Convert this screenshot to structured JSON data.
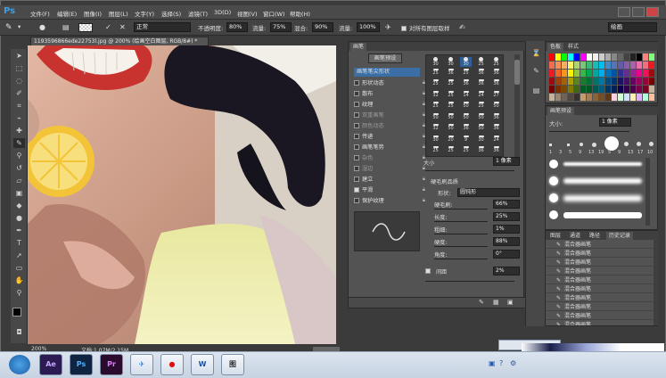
{
  "app": {
    "logo": "Ps"
  },
  "menu": [
    "文件(F)",
    "编辑(E)",
    "图像(I)",
    "图层(L)",
    "文字(Y)",
    "选择(S)",
    "滤镜(T)",
    "3D(D)",
    "视图(V)",
    "窗口(W)",
    "帮助(H)"
  ],
  "options": {
    "mode_value": "正常",
    "opacity_label": "不透明度:",
    "opacity_value": "80%",
    "flow_label": "流量:",
    "flow_value": "75%",
    "mix_label": "混合:",
    "mix_value": "90%",
    "flow2_label": "流量:",
    "flow2_value": "100%",
    "sample_all_label": "对所有图层取样",
    "workspace_value": "绘画"
  },
  "document": {
    "tab_title": "1193596866ede22753l.jpg @ 200% (绘画空白图层, RGB/8#) *",
    "zoom": "200%",
    "doc_info": "文档:1.07M/2.15M"
  },
  "brush_panel": {
    "tabs": [
      "画笔"
    ],
    "presets_button": "画笔预设",
    "tip_shape_label": "画笔笔尖形状",
    "options": [
      {
        "label": "形状动态",
        "checked": false
      },
      {
        "label": "散布",
        "checked": false
      },
      {
        "label": "纹理",
        "checked": false
      },
      {
        "label": "双重画笔",
        "checked": false
      },
      {
        "label": "颜色动态",
        "checked": false
      },
      {
        "label": "传递",
        "checked": false
      },
      {
        "label": "画笔笔势",
        "checked": false
      },
      {
        "label": "杂色",
        "checked": false
      },
      {
        "label": "湿边",
        "checked": false
      },
      {
        "label": "建立",
        "checked": false
      },
      {
        "label": "平滑",
        "checked": true
      },
      {
        "label": "保护纹理",
        "checked": false
      }
    ],
    "tip_sizes": [
      [
        "30",
        "30",
        "30",
        "25",
        "25"
      ],
      [
        "25",
        "36",
        "25",
        "36",
        "36"
      ],
      [
        "25",
        "25",
        "36",
        "36",
        "36"
      ],
      [
        "32",
        "25",
        "14",
        "24",
        "27"
      ],
      [
        "25",
        "25",
        "50",
        "25",
        "50"
      ],
      [
        "50",
        "50",
        "50",
        "50",
        "36"
      ],
      [
        "32",
        "50",
        "36",
        "50",
        "36"
      ],
      [
        "30",
        "20",
        "9",
        "30",
        "24"
      ],
      [
        "25",
        "25",
        "25",
        "36",
        "36"
      ]
    ],
    "size_label": "大小",
    "size_value": "1 像素",
    "bristle_title": "硬毛刷品质",
    "shape_label": "形状:",
    "shape_value": "圆钝形",
    "params": [
      {
        "label": "硬毛刷:",
        "value": "66%"
      },
      {
        "label": "长度:",
        "value": "25%"
      },
      {
        "label": "粗细:",
        "value": "1%"
      },
      {
        "label": "硬度:",
        "value": "88%"
      },
      {
        "label": "角度:",
        "value": "0°"
      }
    ],
    "spacing_label": "间距",
    "spacing_value": "2%"
  },
  "swatches_panel": {
    "tabs": [
      "色板",
      "样式"
    ]
  },
  "brush_presets_panel": {
    "title": "画笔预设",
    "size_label": "大小:",
    "size_value": "1 像素",
    "sizes": [
      "1",
      "3",
      "5",
      "9",
      "13",
      "19",
      "5",
      "9",
      "13",
      "17",
      "10"
    ]
  },
  "history_panel": {
    "tabs": [
      "图层",
      "通道",
      "路径",
      "历史记录"
    ],
    "items": [
      "混合器画笔",
      "混合器画笔",
      "混合器画笔",
      "混合器画笔",
      "混合器画笔",
      "混合器画笔",
      "混合器画笔",
      "混合器画笔",
      "混合器画笔",
      "混合器画笔"
    ]
  },
  "taskbar": {
    "apps": [
      "Ae",
      "Ps",
      "Pr",
      "✈",
      "●",
      "W",
      "图"
    ]
  },
  "colors": {
    "accent": "#3e9ee6",
    "panel": "#535353",
    "app_bg": "#3b3b3b"
  }
}
